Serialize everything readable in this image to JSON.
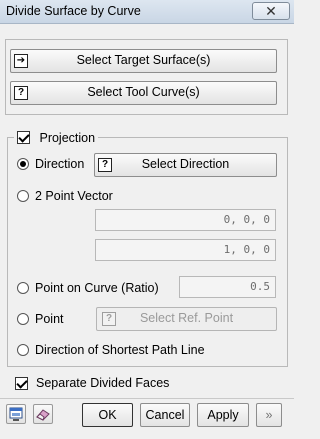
{
  "window": {
    "title": "Divide Surface by Curve",
    "close_glyph": "✕"
  },
  "selection": {
    "target_surface_label": "Select Target Surface(s)",
    "target_surface_icon": "arrow-select-icon",
    "tool_curve_label": "Select Tool Curve(s)",
    "tool_curve_icon": "question-icon"
  },
  "projection": {
    "label": "Projection",
    "checked": true,
    "direction": {
      "label": "Direction",
      "selected": true,
      "button_label": "Select Direction",
      "button_icon": "question-icon"
    },
    "two_point_vector": {
      "label": "2 Point Vector",
      "selected": false,
      "point1": "0, 0, 0",
      "point2": "1, 0, 0"
    },
    "point_on_curve": {
      "label": "Point on Curve (Ratio)",
      "selected": false,
      "value": "0.5"
    },
    "point": {
      "label": "Point",
      "selected": false,
      "button_label": "Select Ref. Point",
      "button_icon": "question-icon",
      "button_enabled": false
    },
    "shortest_path": {
      "label": "Direction of Shortest Path Line",
      "selected": false
    }
  },
  "options": {
    "separate_faces_label": "Separate Divided Faces",
    "separate_faces_checked": true
  },
  "footer": {
    "ok_label": "OK",
    "cancel_label": "Cancel",
    "apply_label": "Apply",
    "expand_glyph": "»",
    "left_icons": [
      "preview-icon",
      "eraser-icon"
    ]
  },
  "icon_glyphs": {
    "question": "?",
    "arrow": "➔"
  }
}
